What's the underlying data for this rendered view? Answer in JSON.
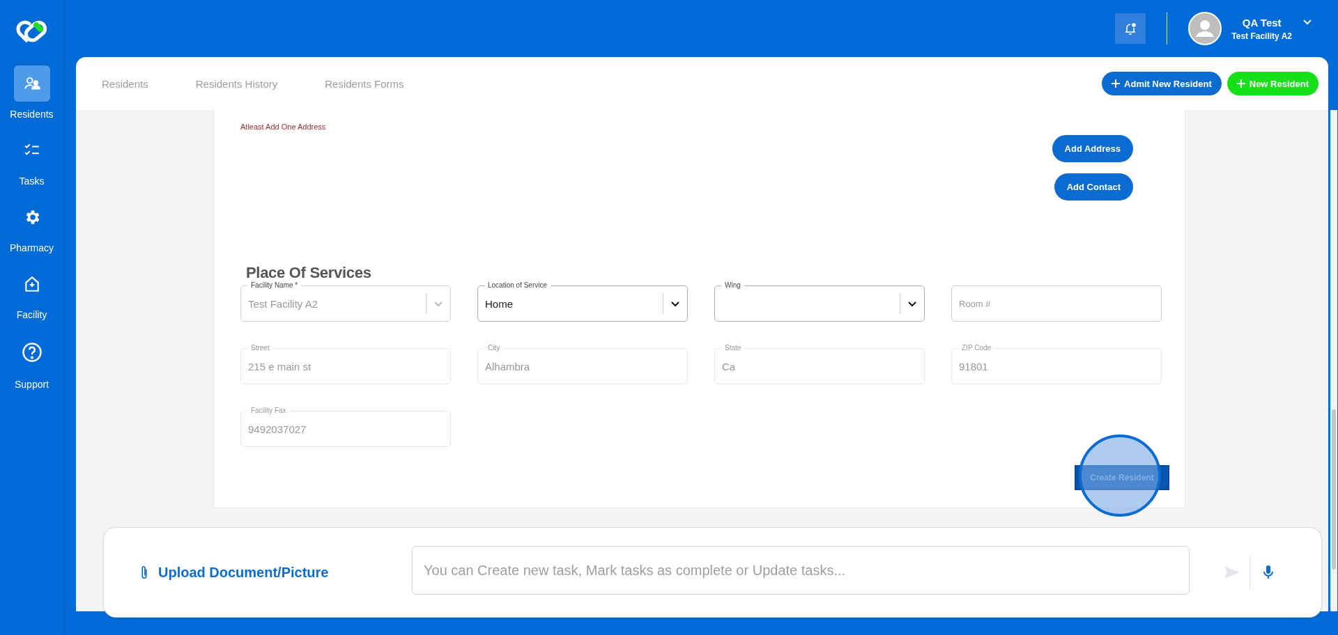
{
  "sidebar": {
    "items": [
      {
        "label": "Residents",
        "selected": true
      },
      {
        "label": "Tasks",
        "selected": false
      },
      {
        "label": "Pharmacy",
        "selected": false
      },
      {
        "label": "Facility",
        "selected": false
      },
      {
        "label": "Support",
        "selected": false
      }
    ]
  },
  "header": {
    "user_name": "QA Test",
    "facility": "Test Facility A2"
  },
  "tabs": [
    {
      "label": "Residents",
      "selected": false
    },
    {
      "label": "Residents History",
      "selected": false
    },
    {
      "label": "Residents Forms",
      "selected": false
    }
  ],
  "actions": [
    {
      "label": "Admit New Resident",
      "kind": "primary"
    },
    {
      "label": "New Resident",
      "kind": "success"
    }
  ],
  "form": {
    "error": "Atleast Add One Address",
    "buttons": [
      "Add Address",
      "Add Contact"
    ],
    "section_title": "Place Of Services",
    "fields": [
      {
        "kind": "select",
        "label": "Facility Name *",
        "value": "Test Facility A2",
        "disabled": true
      },
      {
        "kind": "select",
        "label": "Location of Service",
        "value": "Home",
        "disabled": false
      },
      {
        "kind": "select",
        "label": "Wing",
        "disabled": false
      },
      {
        "kind": "text",
        "placeholder": "Room #",
        "disabled": false
      },
      {
        "kind": "text",
        "label": "Street",
        "value": "215 e main st",
        "disabled": true
      },
      {
        "kind": "text",
        "label": "City",
        "value": "Alhambra",
        "disabled": true
      },
      {
        "kind": "text",
        "label": "State",
        "value": "Ca",
        "disabled": true
      },
      {
        "kind": "text",
        "label": "ZIP Code",
        "value": "91801",
        "disabled": true
      },
      {
        "kind": "text",
        "label": "Facility Fax",
        "value": "9492037027",
        "disabled": true
      }
    ],
    "submit": "Create Resident"
  },
  "chat": {
    "upload": "Upload Document/Picture",
    "placeholder": "You can Create new task, Mark tasks as complete or Update tasks..."
  }
}
